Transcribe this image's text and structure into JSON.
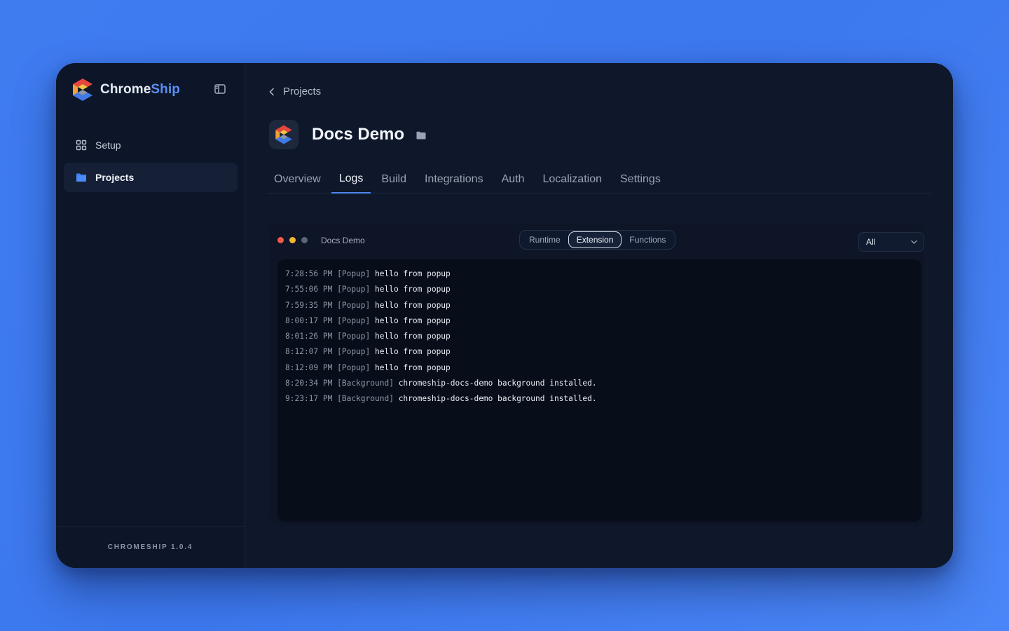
{
  "brand": {
    "name_main": "Chrome",
    "name_accent": "Ship",
    "accent_color": "#5b8ff5"
  },
  "sidebar": {
    "items": [
      {
        "label": "Setup",
        "icon": "grid-icon",
        "active": false
      },
      {
        "label": "Projects",
        "icon": "folder-icon",
        "active": true
      }
    ],
    "footer": "CHROMESHIP 1.0.4"
  },
  "breadcrumb": {
    "back_label": "Projects"
  },
  "project": {
    "title": "Docs Demo"
  },
  "tabs": [
    {
      "label": "Overview",
      "active": false
    },
    {
      "label": "Logs",
      "active": true
    },
    {
      "label": "Build",
      "active": false
    },
    {
      "label": "Integrations",
      "active": false
    },
    {
      "label": "Auth",
      "active": false
    },
    {
      "label": "Localization",
      "active": false
    },
    {
      "label": "Settings",
      "active": false
    }
  ],
  "log_panel": {
    "label": "Docs Demo",
    "segments": [
      {
        "label": "Runtime",
        "active": false
      },
      {
        "label": "Extension",
        "active": true
      },
      {
        "label": "Functions",
        "active": false
      }
    ],
    "filter": {
      "selected": "All"
    },
    "lines": [
      {
        "time": "7:28:56 PM",
        "tag": "[Popup]",
        "message": "hello from popup"
      },
      {
        "time": "7:55:06 PM",
        "tag": "[Popup]",
        "message": "hello from popup"
      },
      {
        "time": "7:59:35 PM",
        "tag": "[Popup]",
        "message": "hello from popup"
      },
      {
        "time": "8:00:17 PM",
        "tag": "[Popup]",
        "message": "hello from popup"
      },
      {
        "time": "8:01:26 PM",
        "tag": "[Popup]",
        "message": "hello from popup"
      },
      {
        "time": "8:12:07 PM",
        "tag": "[Popup]",
        "message": "hello from popup"
      },
      {
        "time": "8:12:09 PM",
        "tag": "[Popup]",
        "message": "hello from popup"
      },
      {
        "time": "8:20:34 PM",
        "tag": "[Background]",
        "message": "chromeship-docs-demo background installed."
      },
      {
        "time": "9:23:17 PM",
        "tag": "[Background]",
        "message": "chromeship-docs-demo background installed."
      }
    ]
  }
}
